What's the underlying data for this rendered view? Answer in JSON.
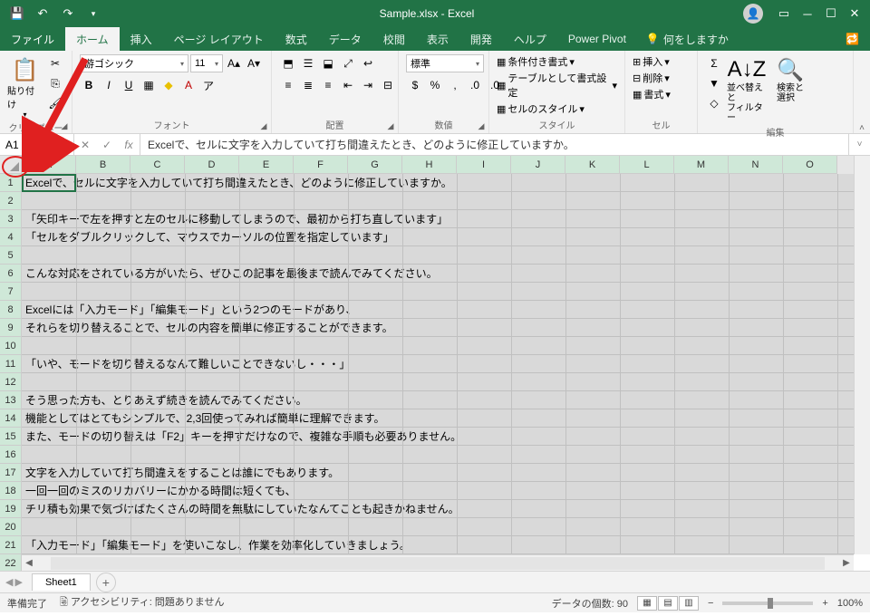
{
  "title": "Sample.xlsx - Excel",
  "tabs": {
    "file": "ファイル",
    "home": "ホーム",
    "insert": "挿入",
    "page_layout": "ページ レイアウト",
    "formulas": "数式",
    "data": "データ",
    "review": "校閲",
    "view": "表示",
    "developer": "開発",
    "help": "ヘルプ",
    "power_pivot": "Power Pivot",
    "tell_me": "何をしますか"
  },
  "ribbon": {
    "clipboard": {
      "label": "クリップボード",
      "paste": "貼り付け"
    },
    "font": {
      "label": "フォント",
      "name": "游ゴシック",
      "size": "11"
    },
    "alignment": {
      "label": "配置"
    },
    "number": {
      "label": "数値",
      "format": "標準"
    },
    "styles": {
      "label": "スタイル",
      "cond": "条件付き書式",
      "table": "テーブルとして書式設定",
      "cell": "セルのスタイル"
    },
    "cells": {
      "label": "セル",
      "insert": "挿入",
      "delete": "削除",
      "format": "書式"
    },
    "editing": {
      "label": "編集",
      "sort": "並べ替えと\nフィルター",
      "find": "検索と\n選択"
    }
  },
  "name_box": "A1",
  "formula": "Excelで、セルに文字を入力していて打ち間違えたとき、どのように修正していますか。",
  "columns": [
    "A",
    "B",
    "C",
    "D",
    "E",
    "F",
    "G",
    "H",
    "I",
    "J",
    "K",
    "L",
    "M",
    "N",
    "O"
  ],
  "rows": [
    "Excelで、セルに文字を入力していて打ち間違えたとき、どのように修正していますか。",
    "",
    "「矢印キーで左を押すと左のセルに移動してしまうので、最初から打ち直しています」",
    "「セルをダブルクリックして、マウスでカーソルの位置を指定しています」",
    "",
    "こんな対応をされている方がいたら、ぜひこの記事を最後まで読んでみてください。",
    "",
    "Excelには「入力モード」「編集モード」という2つのモードがあり、",
    "それらを切り替えることで、セルの内容を簡単に修正することができます。",
    "",
    "「いや、モードを切り替えるなんて難しいことできないし・・・」",
    "",
    "そう思った方も、とりあえず続きを読んでみてください。",
    "機能としてはとてもシンプルで、2,3回使ってみれば簡単に理解できます。",
    "また、モードの切り替えは「F2」キーを押すだけなので、複雑な手順も必要ありません。",
    "",
    "文字を入力していて打ち間違えをすることは誰にでもあります。",
    "一回一回のミスのリカバリーにかかる時間は短くても、",
    "チリ積も効果で気づけばたくさんの時間を無駄にしていたなんてことも起きかねません。",
    "",
    "「入力モード」「編集モード」を使いこなし、作業を効率化していきましょう。"
  ],
  "sheet": {
    "name": "Sheet1"
  },
  "status": {
    "ready": "準備完了",
    "accessibility": "アクセシビリティ: 問題ありません",
    "count": "データの個数: 90",
    "zoom": "100%"
  }
}
